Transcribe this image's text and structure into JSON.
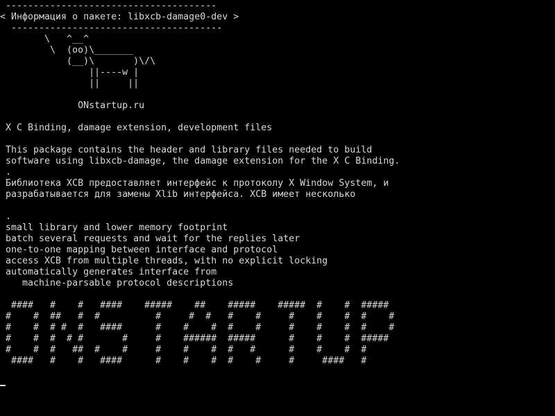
{
  "terminal": {
    "foreground": "#d8d8d8",
    "background": "#000000",
    "cowsay": {
      "border_top": "--------------------------------------",
      "speech": "< Информация о пакете: libxcb-damage0-dev >",
      "border_bottom": " --------------------------------------",
      "cow": [
        "       \\   ^__^",
        "        \\  (oo)\\_______",
        "           (__)\\       )\\/\\",
        "               ||----w |",
        "               ||     ||"
      ]
    },
    "site": "             ONstartup.ru",
    "package_summary": "X C Binding, damage extension, development files",
    "description": [
      "This package contains the header and library files needed to build",
      "software using libxcb-damage, the damage extension for the X C Binding.",
      ".",
      "Библиотека XCB предоставляет интерфейс к протоколу X Window System, и",
      "разрабатывается для замены Xlib интерфейса. XCB имеет несколько"
    ],
    "features": [
      ".",
      "small library and lower memory footprint",
      "batch several requests and wait for the replies later",
      "one-to-one mapping between interface and protocol",
      "access XCB from multiple threads, with no explicit locking",
      "automatically generates interface from",
      "   machine-parsable protocol descriptions"
    ],
    "banner": [
      " ####   #    #   ####    #####    ##    #####    #####  #    #  #####",
      "#    #  ##   #  #          #     #  #   #    #     #    #    #  #    #",
      "#    #  # #  #   ####      #    #    #  #    #     #    #    #  #    #",
      "#    #  #  # #       #     #    ######  #####      #    #    #  #####",
      "#    #  #   ##  #    #     #    #    #  #   #      #    #    #  #",
      " ####   #    #   ####      #    #    #  #    #     #     ####   #"
    ]
  }
}
